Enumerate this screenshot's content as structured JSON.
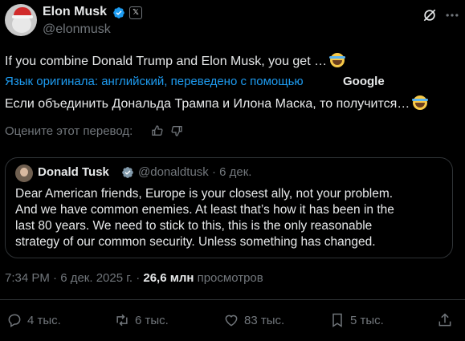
{
  "author": {
    "name": "Elon Musk",
    "handle": "@elonmusk",
    "badge": "𝕏"
  },
  "post": {
    "original_text": "If you combine Donald Trump and Elon Musk, you get …",
    "translation_note": "Язык оригинала: английский, переведено с помощью",
    "translator": "Google",
    "translated_text": "Если объединить Дональда Трампа и Илона Маска, то получится…",
    "rate_prompt": "Оцените этот перевод:"
  },
  "quote": {
    "name": "Donald Tusk",
    "handle_date": "@donaldtusk · 6 дек.",
    "lines": [
      "Dear American friends, Europe is your closest ally, not your problem.",
      "And we have common enemies. At least that’s how it has been in the",
      "last 80 years. We need to stick to this, this is the only reasonable",
      "strategy of our common security. Unless something has changed."
    ]
  },
  "meta": {
    "time_date": "7:34 PM · 6 дек. 2025 г. · ",
    "views_count": "26,6 млн",
    "views_label": " просмотров"
  },
  "actions": {
    "replies": "4 тыс.",
    "reposts": "6 тыс.",
    "likes": "83 тыс.",
    "bookmarks": "5 тыс."
  },
  "colors": {
    "background": "#000000",
    "text": "#e7e9ea",
    "muted": "#71767b",
    "link": "#1d9bf0",
    "border": "#2f3336"
  }
}
